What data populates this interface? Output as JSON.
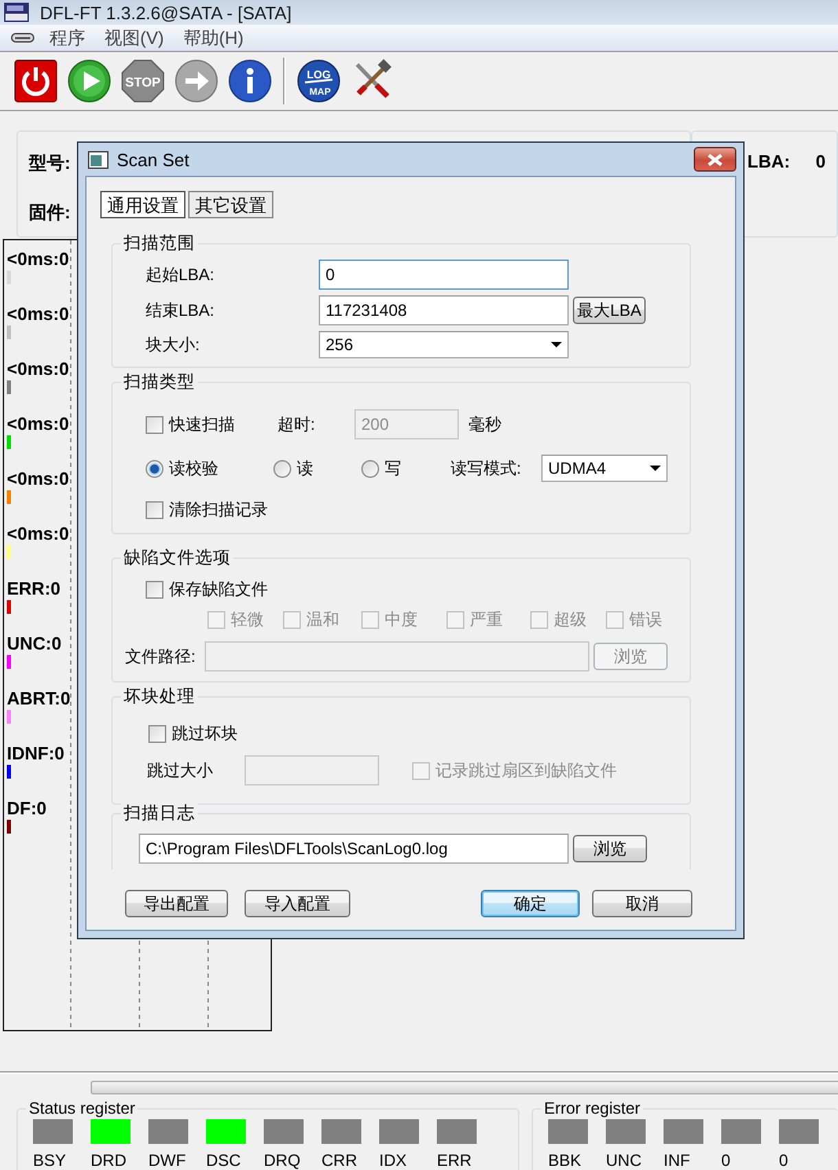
{
  "window": {
    "title": "DFL-FT 1.3.2.6@SATA - [SATA]"
  },
  "menu": [
    "程序",
    "视图(V)",
    "帮助(H)"
  ],
  "toolbar": [
    {
      "kind": "power"
    },
    {
      "kind": "play"
    },
    {
      "kind": "stop",
      "label": "STOP"
    },
    {
      "kind": "arrow"
    },
    {
      "kind": "info"
    },
    {
      "kind": "separator"
    },
    {
      "kind": "logmap",
      "label_top": "LOG",
      "label_bottom": "MAP"
    },
    {
      "kind": "tools"
    }
  ],
  "device_info": {
    "model_label": "型号:",
    "firmware_label": "固件:",
    "lba_label": "LBA:",
    "lba_value": "0"
  },
  "stats": [
    {
      "label": "<0ms:0",
      "color": "#d8d8d8"
    },
    {
      "label": "<0ms:0",
      "color": "#c0c0c0"
    },
    {
      "label": "<0ms:0",
      "color": "#808080"
    },
    {
      "label": "<0ms:0",
      "color": "#00e000"
    },
    {
      "label": "<0ms:0",
      "color": "#ff8000"
    },
    {
      "label": "<0ms:0",
      "color": "#ffff80"
    },
    {
      "label": "ERR:0",
      "color": "#e00000"
    },
    {
      "label": "UNC:0",
      "color": "#ff00ff"
    },
    {
      "label": "ABRT:0",
      "color": "#ff80ff"
    },
    {
      "label": "IDNF:0",
      "color": "#0000ff"
    },
    {
      "label": "DF:0",
      "color": "#800000"
    }
  ],
  "dialog": {
    "title": "Scan Set",
    "tabs": [
      {
        "label": "通用设置",
        "selected": true
      },
      {
        "label": "其它设置",
        "selected": false
      }
    ],
    "scan_range": {
      "title": "扫描范围",
      "start_label": "起始LBA:",
      "start_value": "0",
      "end_label": "结束LBA:",
      "end_value": "117231408",
      "max_button": "最大LBA",
      "block_label": "块大小:",
      "block_value": "256"
    },
    "scan_type": {
      "title": "扫描类型",
      "quick": {
        "label": "快速扫描",
        "checked": false
      },
      "timeout_label": "超时:",
      "timeout_value": "200",
      "timeout_disabled": true,
      "timeout_unit": "毫秒",
      "modes": [
        {
          "label": "读校验",
          "selected": true
        },
        {
          "label": "读",
          "selected": false
        },
        {
          "label": "写",
          "selected": false
        }
      ],
      "rw_label": "读写模式:",
      "rw_value": "UDMA4",
      "clear": {
        "label": "清除扫描记录",
        "checked": false
      }
    },
    "defect": {
      "title": "缺陷文件选项",
      "save": {
        "label": "保存缺陷文件",
        "checked": false
      },
      "levels": [
        {
          "label": "轻微",
          "checked": false,
          "disabled": true
        },
        {
          "label": "温和",
          "checked": false,
          "disabled": true
        },
        {
          "label": "中度",
          "checked": false,
          "disabled": true
        },
        {
          "label": "严重",
          "checked": false,
          "disabled": true
        },
        {
          "label": "超级",
          "checked": false,
          "disabled": true
        },
        {
          "label": "错误",
          "checked": false,
          "disabled": true
        }
      ],
      "path_label": "文件路径:",
      "path_disabled": true,
      "browse": {
        "label": "浏览",
        "disabled": true
      }
    },
    "bad_block": {
      "title": "坏块处理",
      "skip": {
        "label": "跳过坏块",
        "checked": false
      },
      "size_label": "跳过大小",
      "size_disabled": true,
      "record": {
        "label": "记录跳过扇区到缺陷文件",
        "checked": false,
        "disabled": true
      }
    },
    "log": {
      "title": "扫描日志",
      "path": "C:\\Program Files\\DFLTools\\ScanLog0.log",
      "browse": {
        "label": "浏览",
        "disabled": false
      }
    },
    "buttons_left": [
      {
        "label": "导出配置",
        "default": false
      },
      {
        "label": "导入配置",
        "default": false
      }
    ],
    "buttons_right": [
      {
        "label": "确定",
        "default": true
      },
      {
        "label": "取消",
        "default": false
      }
    ]
  },
  "status_register": {
    "title": "Status register",
    "bits": [
      {
        "label": "BSY",
        "on": false
      },
      {
        "label": "DRD",
        "on": true
      },
      {
        "label": "DWF",
        "on": false
      },
      {
        "label": "DSC",
        "on": true
      },
      {
        "label": "DRQ",
        "on": false
      },
      {
        "label": "CRR",
        "on": false
      },
      {
        "label": "IDX",
        "on": false
      },
      {
        "label": "ERR",
        "on": false
      }
    ]
  },
  "error_register": {
    "title": "Error register",
    "bits": [
      {
        "label": "BBK",
        "on": false
      },
      {
        "label": "UNC",
        "on": false
      },
      {
        "label": "INF",
        "on": false
      },
      {
        "label": "0",
        "on": false
      },
      {
        "label": "0",
        "on": false
      }
    ]
  }
}
